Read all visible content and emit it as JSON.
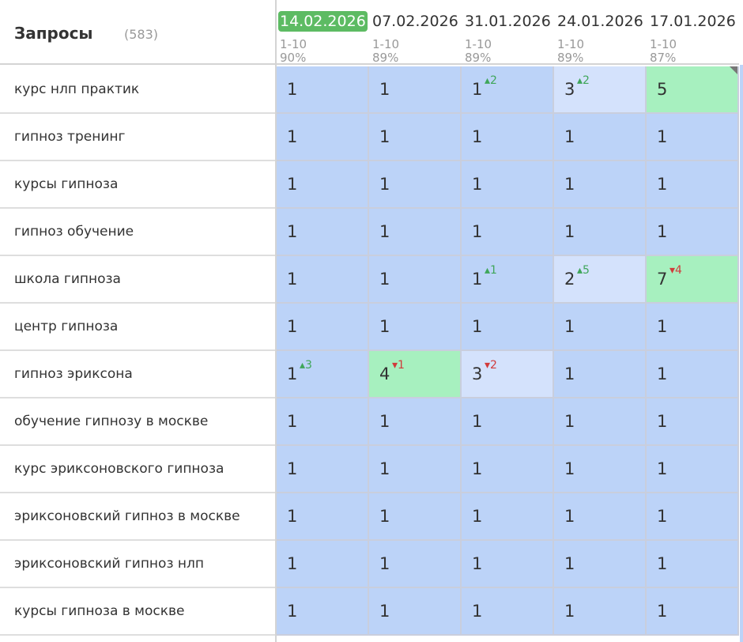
{
  "header": {
    "title": "Запросы",
    "count": "(583)"
  },
  "columns": [
    {
      "date": "14.02.2026",
      "range": "1-10",
      "percent": "90%",
      "current": true
    },
    {
      "date": "07.02.2026",
      "range": "1-10",
      "percent": "89%",
      "current": false
    },
    {
      "date": "31.01.2026",
      "range": "1-10",
      "percent": "89%",
      "current": false
    },
    {
      "date": "24.01.2026",
      "range": "1-10",
      "percent": "89%",
      "current": false
    },
    {
      "date": "17.01.2026",
      "range": "1-10",
      "percent": "87%",
      "current": false
    }
  ],
  "colors": {
    "default": "#bcd3f8",
    "green": "#a7f0bf",
    "light": "#d4e2fc",
    "up": "#3fa65a",
    "down": "#d13b3b"
  },
  "rows": [
    {
      "query": "курс нлп практик",
      "cells": [
        {
          "pos": "1",
          "delta": "",
          "dir": "",
          "bg": "default"
        },
        {
          "pos": "1",
          "delta": "",
          "dir": "",
          "bg": "default"
        },
        {
          "pos": "1",
          "delta": "2",
          "dir": "up",
          "bg": "default"
        },
        {
          "pos": "3",
          "delta": "2",
          "dir": "up",
          "bg": "light"
        },
        {
          "pos": "5",
          "delta": "",
          "dir": "",
          "bg": "green",
          "corner": true
        }
      ]
    },
    {
      "query": "гипноз тренинг",
      "cells": [
        {
          "pos": "1",
          "delta": "",
          "dir": "",
          "bg": "default"
        },
        {
          "pos": "1",
          "delta": "",
          "dir": "",
          "bg": "default"
        },
        {
          "pos": "1",
          "delta": "",
          "dir": "",
          "bg": "default"
        },
        {
          "pos": "1",
          "delta": "",
          "dir": "",
          "bg": "default"
        },
        {
          "pos": "1",
          "delta": "",
          "dir": "",
          "bg": "default"
        }
      ]
    },
    {
      "query": "курсы гипноза",
      "cells": [
        {
          "pos": "1",
          "delta": "",
          "dir": "",
          "bg": "default"
        },
        {
          "pos": "1",
          "delta": "",
          "dir": "",
          "bg": "default"
        },
        {
          "pos": "1",
          "delta": "",
          "dir": "",
          "bg": "default"
        },
        {
          "pos": "1",
          "delta": "",
          "dir": "",
          "bg": "default"
        },
        {
          "pos": "1",
          "delta": "",
          "dir": "",
          "bg": "default"
        }
      ]
    },
    {
      "query": "гипноз обучение",
      "cells": [
        {
          "pos": "1",
          "delta": "",
          "dir": "",
          "bg": "default"
        },
        {
          "pos": "1",
          "delta": "",
          "dir": "",
          "bg": "default"
        },
        {
          "pos": "1",
          "delta": "",
          "dir": "",
          "bg": "default"
        },
        {
          "pos": "1",
          "delta": "",
          "dir": "",
          "bg": "default"
        },
        {
          "pos": "1",
          "delta": "",
          "dir": "",
          "bg": "default"
        }
      ]
    },
    {
      "query": "школа гипноза",
      "cells": [
        {
          "pos": "1",
          "delta": "",
          "dir": "",
          "bg": "default"
        },
        {
          "pos": "1",
          "delta": "",
          "dir": "",
          "bg": "default"
        },
        {
          "pos": "1",
          "delta": "1",
          "dir": "up",
          "bg": "default"
        },
        {
          "pos": "2",
          "delta": "5",
          "dir": "up",
          "bg": "light"
        },
        {
          "pos": "7",
          "delta": "4",
          "dir": "down",
          "bg": "green"
        }
      ]
    },
    {
      "query": "центр гипноза",
      "cells": [
        {
          "pos": "1",
          "delta": "",
          "dir": "",
          "bg": "default"
        },
        {
          "pos": "1",
          "delta": "",
          "dir": "",
          "bg": "default"
        },
        {
          "pos": "1",
          "delta": "",
          "dir": "",
          "bg": "default"
        },
        {
          "pos": "1",
          "delta": "",
          "dir": "",
          "bg": "default"
        },
        {
          "pos": "1",
          "delta": "",
          "dir": "",
          "bg": "default"
        }
      ]
    },
    {
      "query": "гипноз эриксона",
      "cells": [
        {
          "pos": "1",
          "delta": "3",
          "dir": "up",
          "bg": "default"
        },
        {
          "pos": "4",
          "delta": "1",
          "dir": "down",
          "bg": "green"
        },
        {
          "pos": "3",
          "delta": "2",
          "dir": "down",
          "bg": "light"
        },
        {
          "pos": "1",
          "delta": "",
          "dir": "",
          "bg": "default"
        },
        {
          "pos": "1",
          "delta": "",
          "dir": "",
          "bg": "default"
        }
      ]
    },
    {
      "query": "обучение гипнозу в москве",
      "cells": [
        {
          "pos": "1",
          "delta": "",
          "dir": "",
          "bg": "default"
        },
        {
          "pos": "1",
          "delta": "",
          "dir": "",
          "bg": "default"
        },
        {
          "pos": "1",
          "delta": "",
          "dir": "",
          "bg": "default"
        },
        {
          "pos": "1",
          "delta": "",
          "dir": "",
          "bg": "default"
        },
        {
          "pos": "1",
          "delta": "",
          "dir": "",
          "bg": "default"
        }
      ]
    },
    {
      "query": "курс эриксоновского гипноза",
      "cells": [
        {
          "pos": "1",
          "delta": "",
          "dir": "",
          "bg": "default"
        },
        {
          "pos": "1",
          "delta": "",
          "dir": "",
          "bg": "default"
        },
        {
          "pos": "1",
          "delta": "",
          "dir": "",
          "bg": "default"
        },
        {
          "pos": "1",
          "delta": "",
          "dir": "",
          "bg": "default"
        },
        {
          "pos": "1",
          "delta": "",
          "dir": "",
          "bg": "default"
        }
      ]
    },
    {
      "query": "эриксоновский гипноз в москве",
      "cells": [
        {
          "pos": "1",
          "delta": "",
          "dir": "",
          "bg": "default"
        },
        {
          "pos": "1",
          "delta": "",
          "dir": "",
          "bg": "default"
        },
        {
          "pos": "1",
          "delta": "",
          "dir": "",
          "bg": "default"
        },
        {
          "pos": "1",
          "delta": "",
          "dir": "",
          "bg": "default"
        },
        {
          "pos": "1",
          "delta": "",
          "dir": "",
          "bg": "default"
        }
      ]
    },
    {
      "query": "эриксоновский гипноз нлп",
      "cells": [
        {
          "pos": "1",
          "delta": "",
          "dir": "",
          "bg": "default"
        },
        {
          "pos": "1",
          "delta": "",
          "dir": "",
          "bg": "default"
        },
        {
          "pos": "1",
          "delta": "",
          "dir": "",
          "bg": "default"
        },
        {
          "pos": "1",
          "delta": "",
          "dir": "",
          "bg": "default"
        },
        {
          "pos": "1",
          "delta": "",
          "dir": "",
          "bg": "default"
        }
      ]
    },
    {
      "query": "курсы гипноза в москве",
      "cells": [
        {
          "pos": "1",
          "delta": "",
          "dir": "",
          "bg": "default"
        },
        {
          "pos": "1",
          "delta": "",
          "dir": "",
          "bg": "default"
        },
        {
          "pos": "1",
          "delta": "",
          "dir": "",
          "bg": "default"
        },
        {
          "pos": "1",
          "delta": "",
          "dir": "",
          "bg": "default"
        },
        {
          "pos": "1",
          "delta": "",
          "dir": "",
          "bg": "default"
        }
      ]
    }
  ]
}
